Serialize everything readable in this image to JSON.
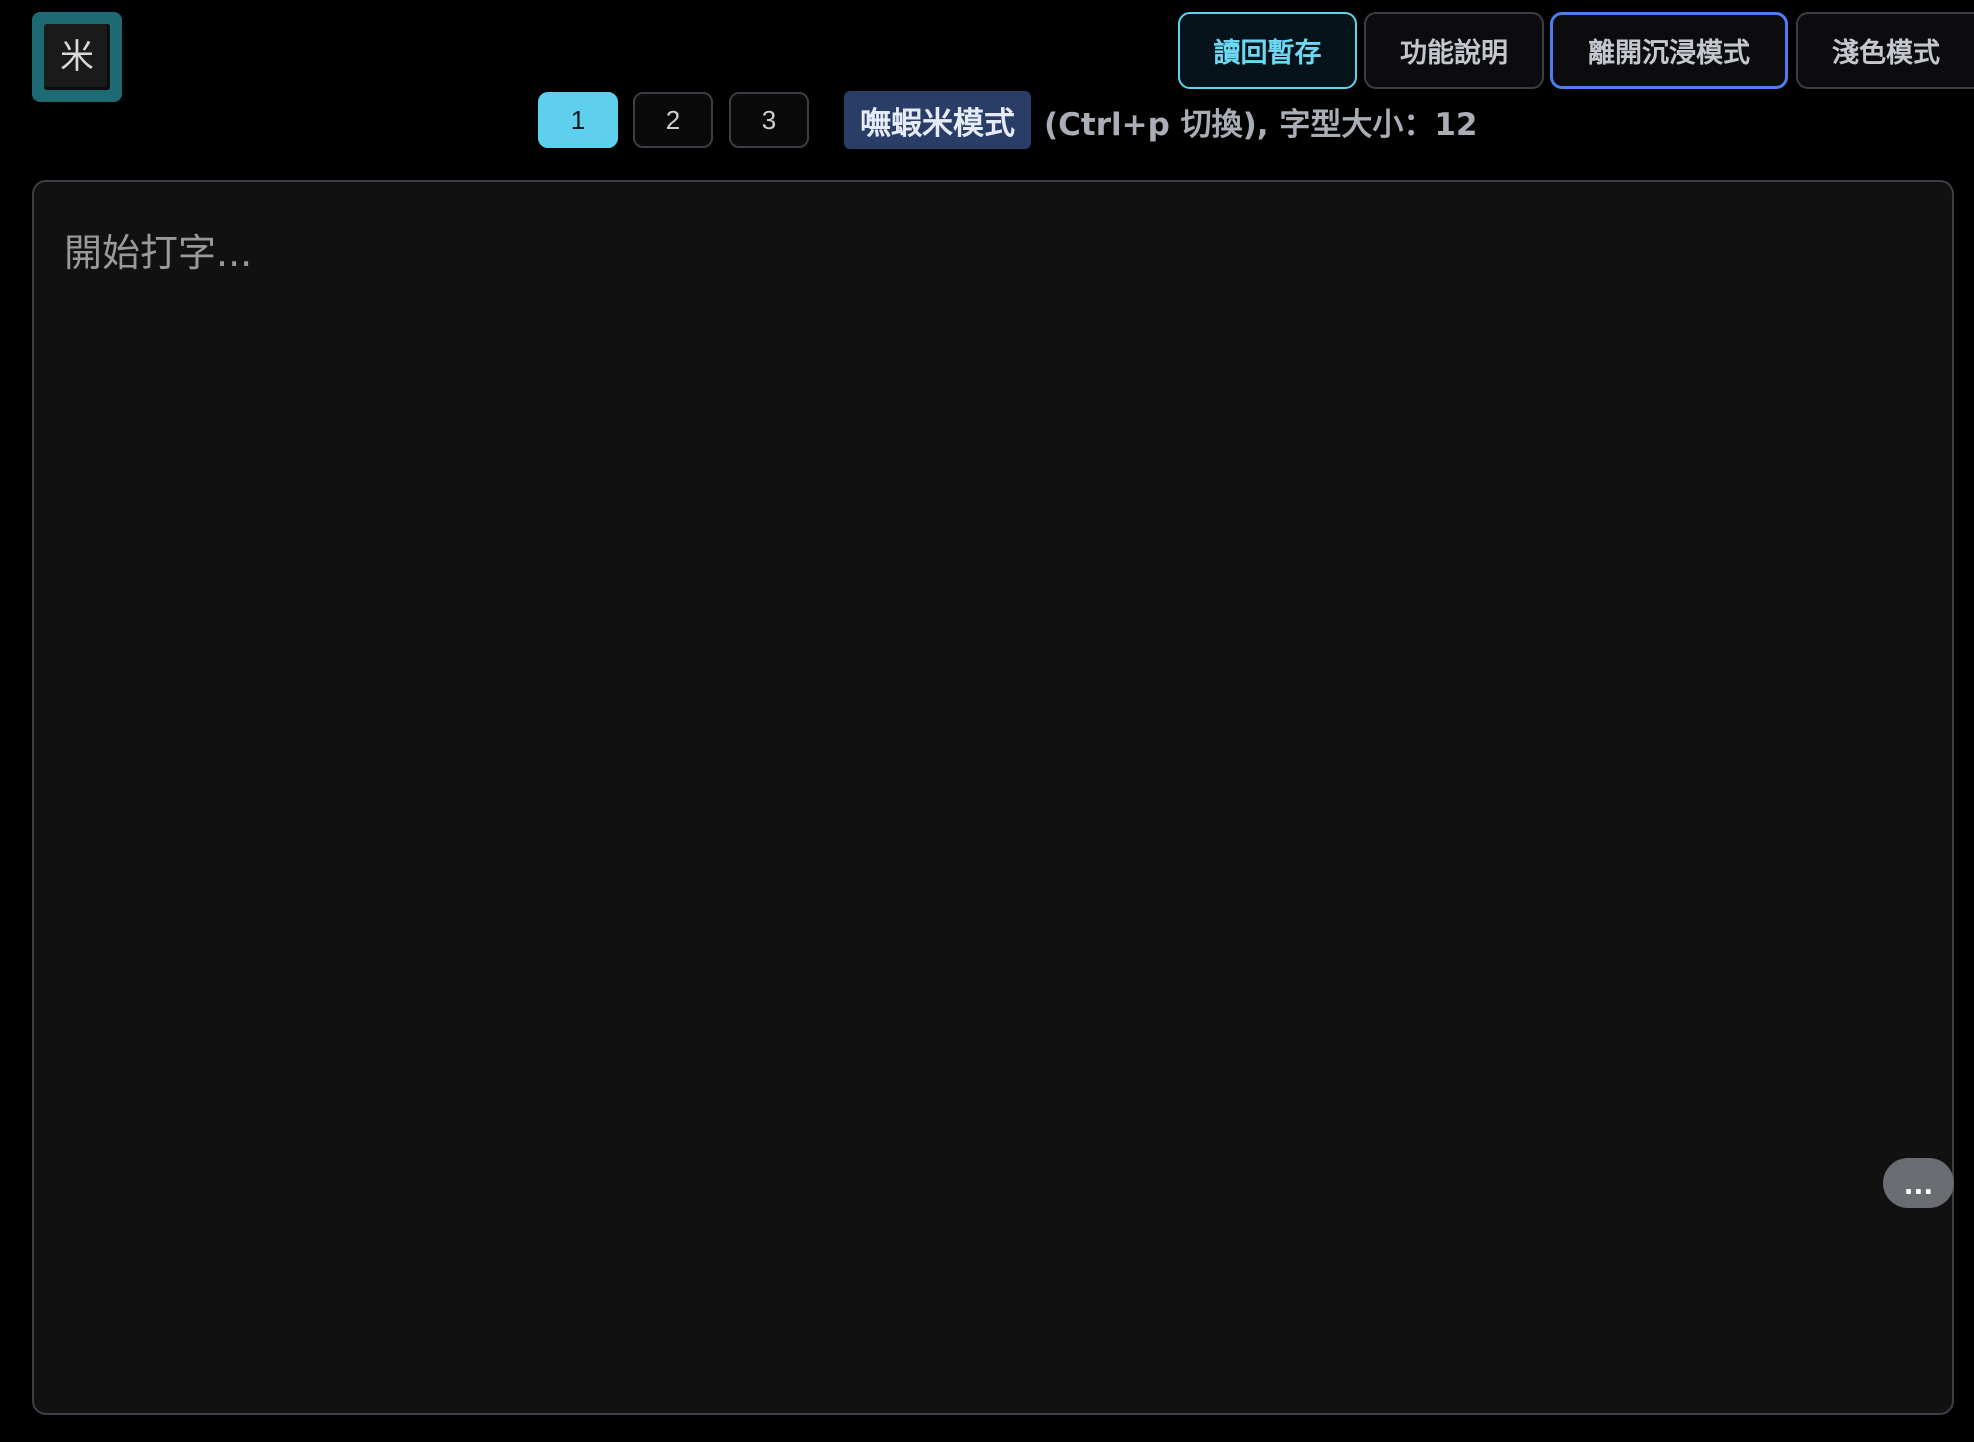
{
  "logo": {
    "glyph": "米"
  },
  "header": {
    "buttons": {
      "load_draft": "讀回暫存",
      "help": "功能說明",
      "exit_immersive": "離開沉浸模式",
      "light_mode": "淺色模式"
    }
  },
  "pages": [
    "1",
    "2",
    "3"
  ],
  "active_page": "1",
  "mode": {
    "badge": "嘸蝦米模式",
    "hint": "(Ctrl+p 切換), 字型大小：12"
  },
  "editor": {
    "placeholder": "開始打字..."
  },
  "more_button": {
    "label": "..."
  },
  "colors": {
    "accent": "#5ed0ed",
    "badge": "#2a3d66",
    "focus_ring": "#4c7ef0",
    "logo": "#1d6a72",
    "background": "#000000",
    "editor_background": "#111111"
  }
}
